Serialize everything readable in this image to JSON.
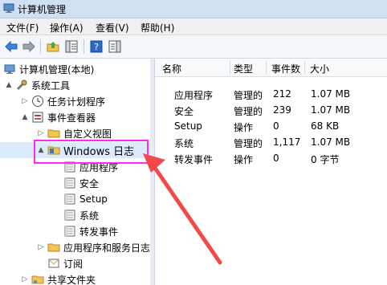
{
  "window": {
    "title": "计算机管理"
  },
  "menu": [
    "文件(F)",
    "操作(A)",
    "查看(V)",
    "帮助(H)"
  ],
  "tree": [
    {
      "label": "计算机管理(本地)",
      "level": 0,
      "expander": "",
      "icon": "computer-icon"
    },
    {
      "label": "系统工具",
      "level": 1,
      "expander": "▲",
      "icon": "tools-icon"
    },
    {
      "label": "任务计划程序",
      "level": 2,
      "expander": "▷",
      "icon": "clock-icon"
    },
    {
      "label": "事件查看器",
      "level": 2,
      "expander": "▲",
      "icon": "event-viewer-icon"
    },
    {
      "label": "自定义视图",
      "level": 3,
      "expander": "▷",
      "icon": "folder-icon"
    },
    {
      "label": "Windows 日志",
      "level": 3,
      "expander": "▲",
      "icon": "folder-icon"
    },
    {
      "label": "应用程序",
      "level": 4,
      "expander": "",
      "icon": "log-icon"
    },
    {
      "label": "安全",
      "level": 4,
      "expander": "",
      "icon": "log-icon"
    },
    {
      "label": "Setup",
      "level": 4,
      "expander": "",
      "icon": "log-icon"
    },
    {
      "label": "系统",
      "level": 4,
      "expander": "",
      "icon": "log-icon"
    },
    {
      "label": "转发事件",
      "level": 4,
      "expander": "",
      "icon": "log-icon"
    },
    {
      "label": "应用程序和服务日志",
      "level": 3,
      "expander": "▷",
      "icon": "folder-icon"
    },
    {
      "label": "订阅",
      "level": 3,
      "expander": "",
      "icon": "subscription-icon"
    },
    {
      "label": "共享文件夹",
      "level": 2,
      "expander": "▷",
      "icon": "shared-folder-icon"
    }
  ],
  "list": {
    "headers": [
      "名称",
      "类型",
      "事件数",
      "大小"
    ],
    "rows": [
      [
        "应用程序",
        "管理的",
        "212",
        "1.07 MB"
      ],
      [
        "安全",
        "管理的",
        "239",
        "1.07 MB"
      ],
      [
        "Setup",
        "操作",
        "0",
        "68 KB"
      ],
      [
        "系统",
        "管理的",
        "1,117",
        "1.07 MB"
      ],
      [
        "转发事件",
        "操作",
        "0",
        "0 字节"
      ]
    ]
  },
  "colors": {
    "highlight": "#ff2bf4",
    "arrow": "#f14a4a"
  }
}
